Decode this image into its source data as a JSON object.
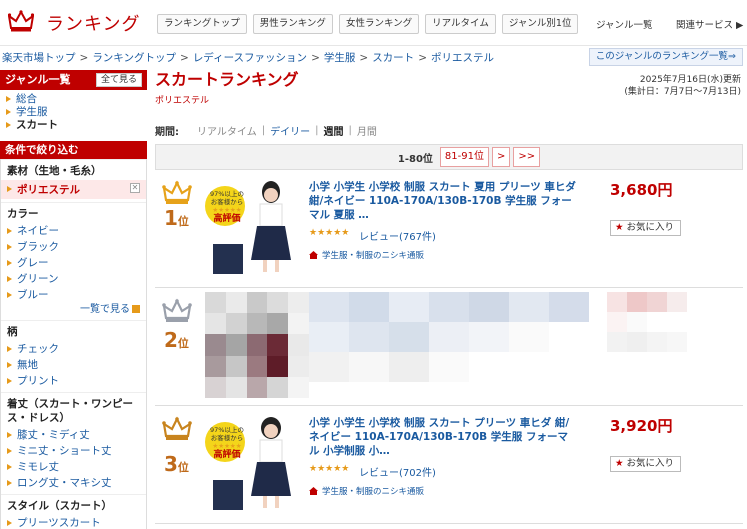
{
  "header": {
    "logo_text": "ランキング",
    "nav": [
      "ランキングトップ",
      "男性ランキング",
      "女性ランキング",
      "リアルタイム",
      "ジャンル別1位"
    ],
    "genre_list": "ジャンル一覧",
    "related": "関連サービス ▶"
  },
  "breadcrumb": [
    "楽天市場トップ",
    "ランキングトップ",
    "レディースファッション",
    "学生服",
    "スカート",
    "ポリエステル"
  ],
  "genre_ranking_link": "このジャンルのランキング一覧⇒",
  "sidebar": {
    "genre_title": "ジャンル一覧",
    "show_all": "全て見る",
    "genres": [
      "総合",
      "学生服",
      "スカート"
    ],
    "filter_title": "条件で絞り込む",
    "material_title": "素材（生地・毛糸）",
    "material_selected": "ポリエステル",
    "color_title": "カラー",
    "colors": [
      "ネイビー",
      "ブラック",
      "グレー",
      "グリーン",
      "ブルー"
    ],
    "more_label": "一覧で見る",
    "pattern_title": "柄",
    "patterns": [
      "チェック",
      "無地",
      "プリント"
    ],
    "length_title": "着丈（スカート・ワンピース・ドレス）",
    "lengths": [
      "膝丈・ミディ丈",
      "ミニ丈・ショート丈",
      "ミモレ丈",
      "ロング丈・マキシ丈"
    ],
    "style_title": "スタイル（スカート）",
    "styles": [
      "プリーツスカート"
    ]
  },
  "main": {
    "title": "スカートランキング",
    "subtitle": "ポリエステル",
    "updated": "2025年7月16日(水)更新",
    "period_range": "(集計日：7月7日～7月13日)",
    "period_label": "期間:",
    "periods": {
      "realtime": "リアルタイム",
      "daily": "デイリー",
      "weekly": "週間",
      "monthly": "月間"
    },
    "pager": {
      "current": "1-80位",
      "next_range": "81-91位",
      "next": ">",
      "last": ">>"
    }
  },
  "items": [
    {
      "rank": "1",
      "rank_suffix": "位",
      "title": "小学 小学生 小学校 制服 スカート 夏用 プリーツ 車ヒダ 紺/ネイビー 110A-170A/130B-170B 学生服 フォーマル 夏服 …",
      "stars": "★★★★★",
      "review": "レビュー(767件)",
      "shop": "学生服・制服のニシキ通販",
      "price": "3,680円",
      "fav": "お気に入り",
      "badge_line1": "97%以上の",
      "badge_line2": "お客様から",
      "badge_line3": "★★★★★",
      "badge_line4": "高評価"
    },
    {
      "rank": "2",
      "rank_suffix": "位"
    },
    {
      "rank": "3",
      "rank_suffix": "位",
      "title": "小学 小学生 小学校 制服 スカート プリーツ 車ヒダ 紺/ネイビー 110A-170A/130B-170B 学生服 フォーマル 小学制服 小…",
      "stars": "★★★★★",
      "review": "レビュー(702件)",
      "shop": "学生服・制服のニシキ通販",
      "price": "3,920円",
      "fav": "お気に入り",
      "badge_line1": "97%以上の",
      "badge_line2": "お客様から",
      "badge_line3": "★★★★★",
      "badge_line4": "高評価"
    }
  ],
  "colors": {
    "brand_red": "#bf0000",
    "link_blue": "#1a5aa0",
    "gold": "#e6a21a",
    "silver": "#9aa0ab",
    "bronze": "#c8841e"
  }
}
